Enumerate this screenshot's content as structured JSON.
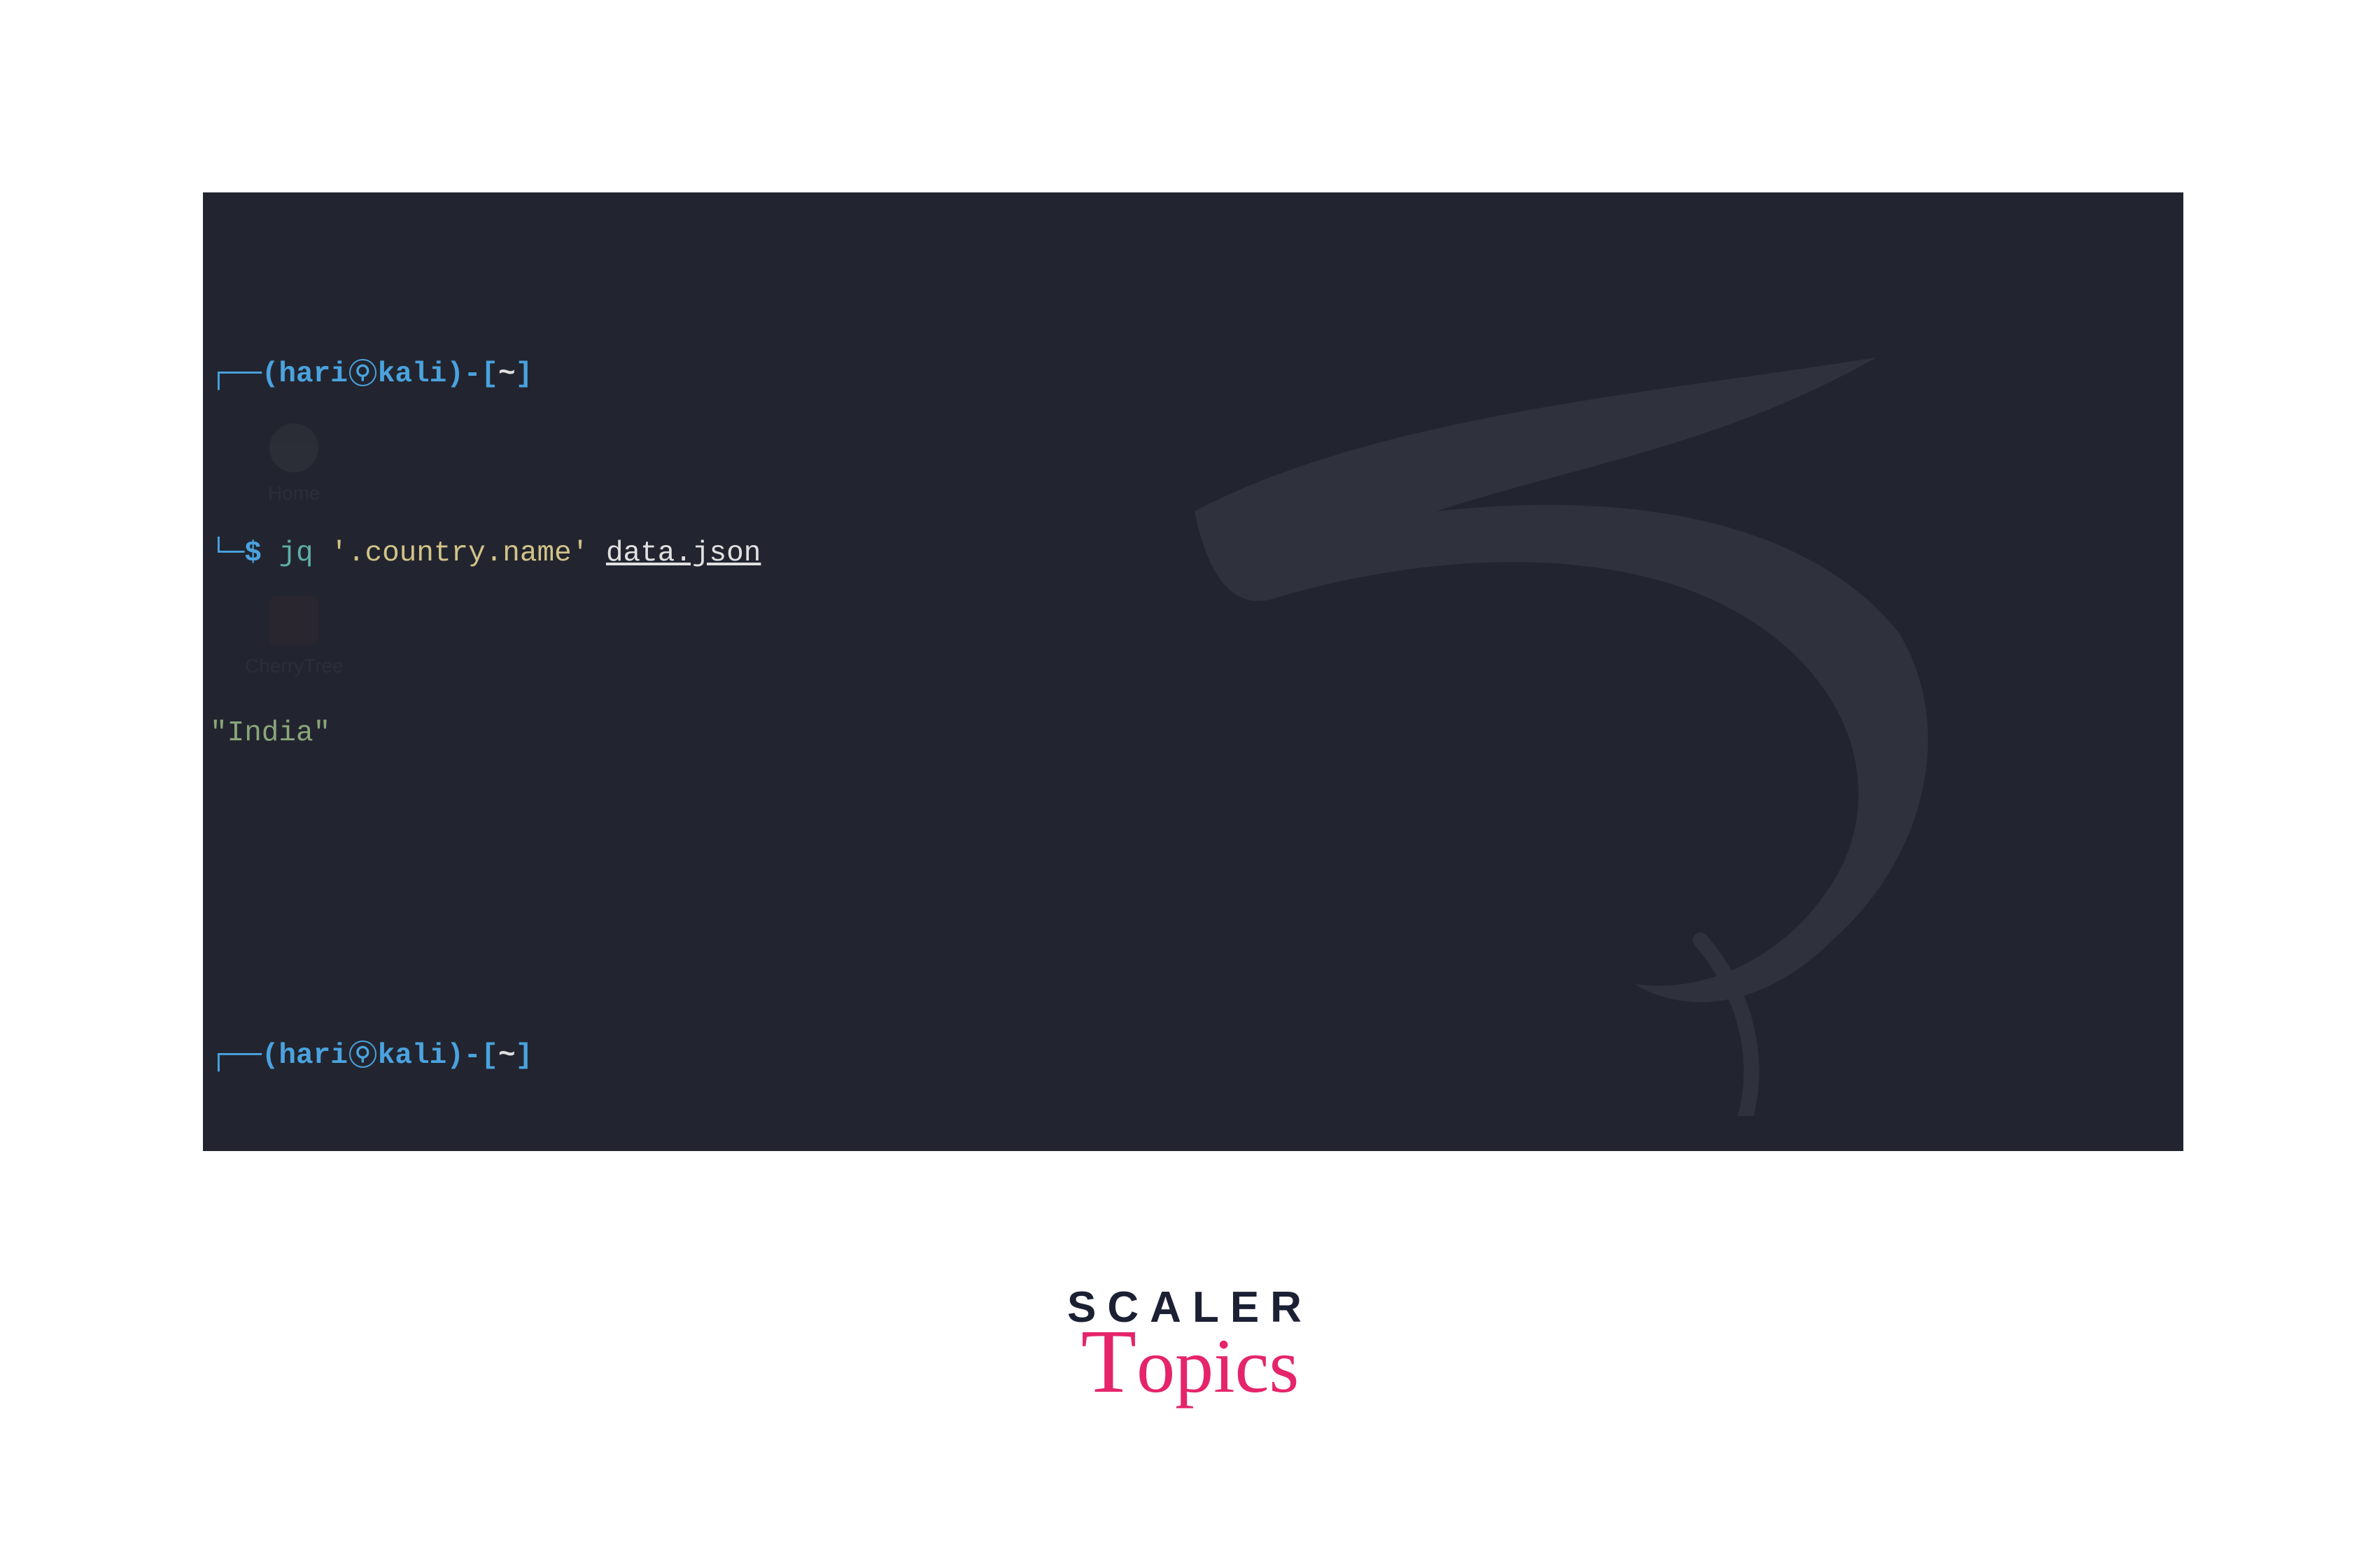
{
  "terminal": {
    "prompt1": {
      "user": "hari",
      "host": "kali",
      "cwd": "~",
      "command_jq": "jq",
      "command_arg": "'.country.name'",
      "command_file": "data.json"
    },
    "output1": "\"India\"",
    "prompt2": {
      "user": "hari",
      "host": "kali",
      "cwd": "~"
    }
  },
  "desktop": {
    "icon1_label": "Home",
    "icon2_label": "CherryTree"
  },
  "branding": {
    "scaler": "SCALER",
    "topics": "Topics"
  }
}
